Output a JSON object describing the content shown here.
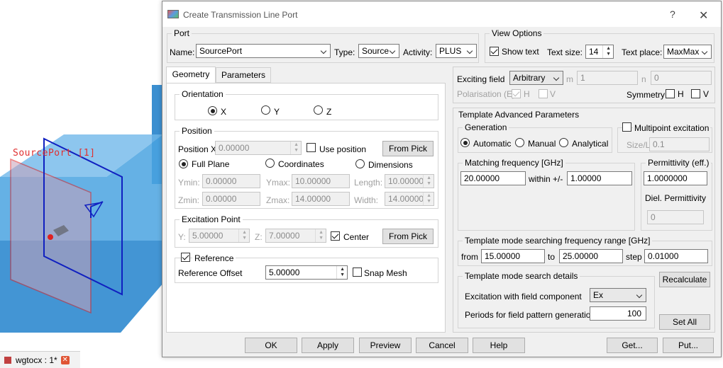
{
  "background": {
    "port_label": "SourcePort [1]",
    "tab_label": "wgtocx : 1*",
    "tab_close": "✕"
  },
  "dialog": {
    "title": "Create Transmission Line Port",
    "help_label": "?",
    "close_label": "✕"
  },
  "port": {
    "group": "Port",
    "name_label": "Name:",
    "name_value": "SourcePort",
    "type_label": "Type:",
    "type_value": "Source",
    "activity_label": "Activity:",
    "activity_value": "PLUS"
  },
  "view_options": {
    "group": "View Options",
    "show_text_label": "Show text",
    "text_size_label": "Text size:",
    "text_size_value": "14",
    "text_place_label": "Text place:",
    "text_place_value": "MaxMax"
  },
  "tabs": [
    {
      "label": "Geometry"
    },
    {
      "label": "Parameters"
    }
  ],
  "orientation": {
    "group": "Orientation",
    "options": [
      "X",
      "Y",
      "Z"
    ]
  },
  "position": {
    "group": "Position",
    "position_x_label": "Position X",
    "position_x_value": "0.00000",
    "use_position_label": "Use position",
    "from_pick_label": "From Pick",
    "full_plane_label": "Full Plane",
    "coordinates_label": "Coordinates",
    "dimensions_label": "Dimensions",
    "ymin_label": "Ymin:",
    "ymin_value": "0.00000",
    "ymax_label": "Ymax:",
    "ymax_value": "10.00000",
    "length_label": "Length:",
    "length_value": "10.00000",
    "zmin_label": "Zmin:",
    "zmin_value": "0.00000",
    "zmax_label": "Zmax:",
    "zmax_value": "14.00000",
    "width_label": "Width:",
    "width_value": "14.00000"
  },
  "excitation_point": {
    "group": "Excitation Point",
    "y_label": "Y:",
    "y_value": "5.00000",
    "z_label": "Z:",
    "z_value": "7.00000",
    "center_label": "Center",
    "from_pick_label": "From Pick"
  },
  "reference": {
    "label": "Reference",
    "offset_label": "Reference Offset",
    "offset_value": "5.00000",
    "snap_mesh_label": "Snap Mesh"
  },
  "exciting": {
    "field_label": "Exciting field",
    "field_value": "Arbitrary",
    "m_label": "m",
    "m_value": "1",
    "n_label": "n",
    "n_value": "0",
    "polarisation_label": "Polarisation (E)",
    "h_label": "H",
    "v_label": "V",
    "symmetry_label": "Symmetry",
    "sym_h_label": "H",
    "sym_v_label": "V"
  },
  "template": {
    "group": "Template Advanced Parameters",
    "generation_group": "Generation",
    "automatic_label": "Automatic",
    "manual_label": "Manual",
    "analytical_label": "Analytical",
    "multipoint_label": "Multipoint excitation",
    "size_l_label": "Size/L",
    "size_l_value": "0.1",
    "matching_group": "Matching frequency [GHz]",
    "matching_value": "20.00000",
    "within_label": "within +/-",
    "within_value": "1.00000",
    "permittivity_group": "Permittivity (eff.)",
    "permittivity_value": "1.0000000",
    "diel_group": "Diel. Permittivity",
    "diel_value": "0",
    "range_group": "Template mode searching frequency range [GHz]",
    "from_label": "from",
    "from_value": "15.00000",
    "to_label": "to",
    "to_value": "25.00000",
    "step_label": "step",
    "step_value": "0.01000",
    "details_group": "Template mode search details",
    "excitation_component_label": "Excitation with field component",
    "excitation_component_value": "Ex",
    "periods_label": "Periods for field pattern generation",
    "periods_value": "100",
    "recalculate_label": "Recalculate",
    "set_all_label": "Set All"
  },
  "footer": {
    "ok": "OK",
    "apply": "Apply",
    "preview": "Preview",
    "cancel": "Cancel",
    "help": "Help",
    "get": "Get...",
    "put": "Put..."
  }
}
